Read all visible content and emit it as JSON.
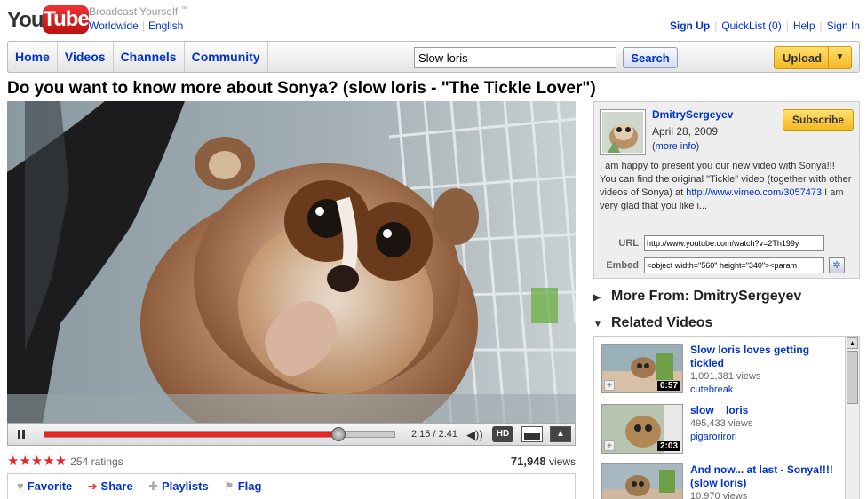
{
  "header": {
    "logo_you": "You",
    "logo_tube": "Tube",
    "tagline": "Broadcast Yourself",
    "tagline_tm": "™",
    "locale_region": "Worldwide",
    "locale_language": "English",
    "sign_up": "Sign Up",
    "quicklist": "QuickList (0)",
    "help": "Help",
    "sign_in": "Sign In"
  },
  "nav": {
    "tabs": [
      "Home",
      "Videos",
      "Channels",
      "Community"
    ],
    "search_value": "Slow loris",
    "search_button": "Search",
    "upload_button": "Upload"
  },
  "video": {
    "title": "Do you want to know more about Sonya? (slow loris - \"The Tickle Lover\")",
    "time": "2:15 / 2:41",
    "progress_fraction": 0.84,
    "hd_label": "HD",
    "stars": "★★★★★",
    "ratings": "254 ratings",
    "views_number": "71,948",
    "views_label": " views"
  },
  "actions": {
    "favorite": "Favorite",
    "share": "Share",
    "playlists": "Playlists",
    "flag": "Flag"
  },
  "channel": {
    "name": "DmitrySergeyev",
    "date": "April 28, 2009",
    "more_info": "more info",
    "subscribe": "Subscribe",
    "description_pre": "I am happy to present you our new video with Sonya!!! You can find the original \"Tickle\" video (together with other videos of Sonya) at ",
    "description_link": "http://www.vimeo.com/3057473",
    "description_post": " I am very glad that you like i...",
    "url_label": "URL",
    "url_value": "http://www.youtube.com/watch?v=2Th199y",
    "embed_label": "Embed",
    "embed_value": "<object width=\"560\" height=\"340\"><param"
  },
  "sections": {
    "more_from": "More From: DmitrySergeyev",
    "related": "Related Videos"
  },
  "related": [
    {
      "title": "Slow loris loves getting tickled",
      "views": "1,091,381 views",
      "user": "cutebreak",
      "duration": "0:57"
    },
    {
      "title": "slow    loris",
      "views": "495,433 views",
      "user": "pigarorirori",
      "duration": "2:03"
    },
    {
      "title": "And now... at last - Sonya!!!! (slow loris)",
      "views": "10,970 views",
      "user": "",
      "duration": ""
    }
  ],
  "colors": {
    "link": "#0033cc",
    "progress": "#ee2222",
    "star": "#ee2222",
    "upload": "#f5b820"
  }
}
